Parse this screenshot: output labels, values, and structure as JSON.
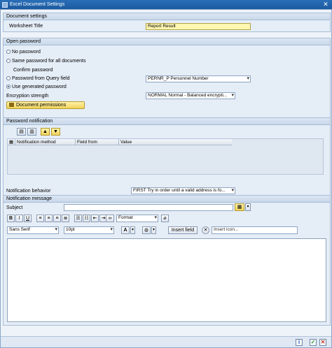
{
  "window": {
    "title": "Excel Document Settings"
  },
  "document_settings": {
    "header": "Document settings",
    "worksheet_title_label": "Worksheet Title",
    "worksheet_title_value": "Report Result"
  },
  "open_password": {
    "header": "Open password",
    "options": [
      {
        "label": "No password",
        "selected": false
      },
      {
        "label": "Same password for all documents",
        "selected": false
      },
      {
        "label": "Password from Query field",
        "selected": false
      },
      {
        "label": "Use generated password",
        "selected": true
      }
    ],
    "confirm_label": "Confirm password",
    "query_field_value": "PERNR_P Personnel Number",
    "encryption_label": "Encryption strength",
    "encryption_value": "NORMAL Normal - Balanced encrypti...",
    "permissions_button": "Document permissions"
  },
  "password_notification": {
    "header": "Password notification",
    "columns": [
      "Notification method",
      "Field from",
      "Value"
    ],
    "behavior_label": "Notification behavior",
    "behavior_value": "FIRST Try in order until a valid address is fo..."
  },
  "notification_message": {
    "header": "Notification message",
    "subject_label": "Subject",
    "subject_value": "",
    "format_value": "Format",
    "font_value": "Sans Serif",
    "size_value": "10pt",
    "insert_field_button": "Insert field",
    "insert_icon_placeholder": "Insert icon..."
  },
  "colors": {
    "title_bar": "#1b5aa0",
    "highlight": "#fff6b0",
    "accept": "#2e9a2e",
    "cancel": "#c43b2b"
  }
}
